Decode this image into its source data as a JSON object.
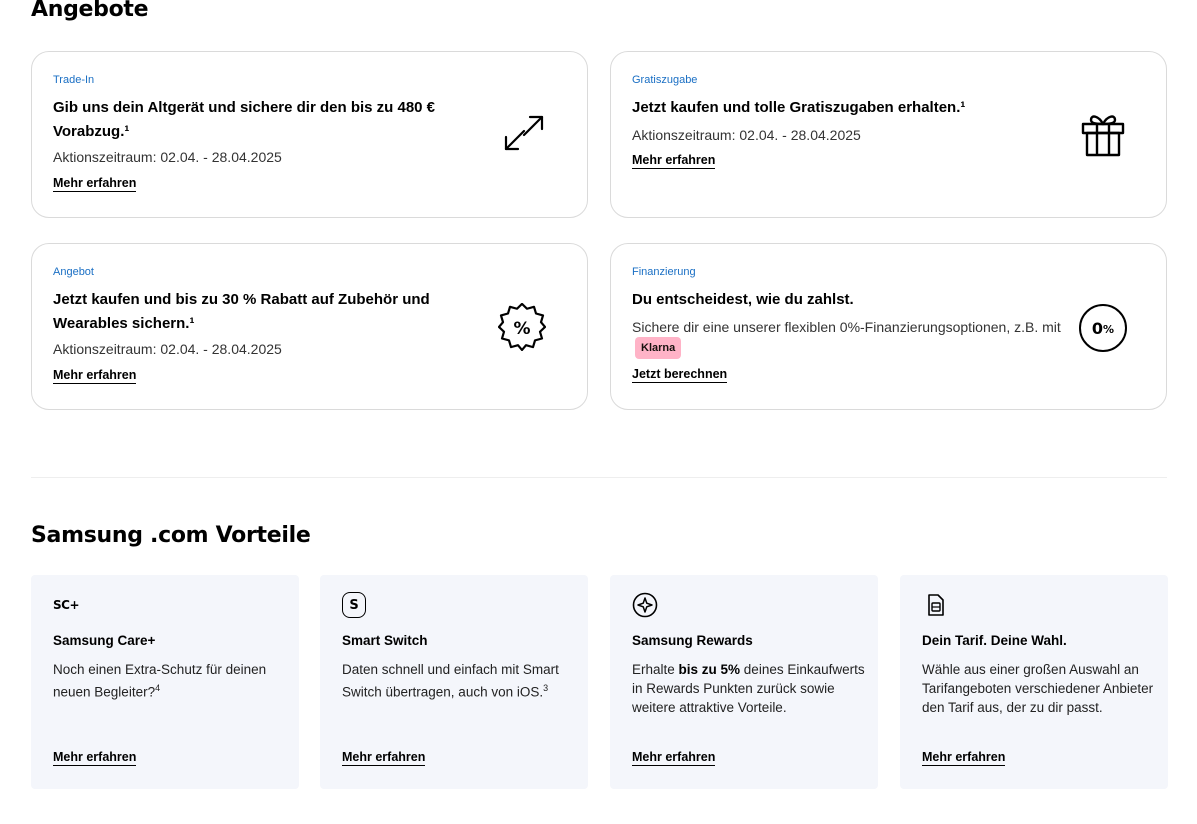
{
  "offers": {
    "title": "Angebote",
    "cards": [
      {
        "eyebrow": "Trade-In",
        "headline": "Gib uns dein Altgerät und sichere dir den bis zu 480 € Vorabzug.¹",
        "sub": "Aktionszeitraum: 02.04. - 28.04.2025",
        "link": "Mehr erfahren",
        "icon": "arrows-swap-icon"
      },
      {
        "eyebrow": "Gratiszugabe",
        "headline": "Jetzt kaufen und tolle Gratiszugaben erhalten.¹",
        "sub": "Aktionszeitraum: 02.04. - 28.04.2025",
        "link": "Mehr erfahren",
        "icon": "gift-icon"
      },
      {
        "eyebrow": "Angebot",
        "headline": "Jetzt kaufen und bis zu 30 % Rabatt auf Zubehör und Wearables sichern.¹",
        "sub": "Aktionszeitraum: 02.04. - 28.04.2025",
        "link": "Mehr erfahren",
        "icon": "percent-badge-icon"
      },
      {
        "eyebrow": "Finanzierung",
        "headline": "Du entscheidest, wie du zahlst.",
        "sub": "Sichere dir eine unserer flexiblen 0%-Finanzierungsoptionen, z.B. mit",
        "badge": "Klarna",
        "link": "Jetzt berechnen",
        "icon": "zero-percent-icon",
        "icon_text": "0",
        "icon_text_small": "%"
      }
    ]
  },
  "benefits": {
    "title": "Samsung .com Vorteile",
    "cards": [
      {
        "icon": "samsung-care-plus-icon",
        "icon_text": "SC+",
        "title": "Samsung Care+",
        "desc": "Noch einen Extra-Schutz für deinen neuen Begleiter?",
        "desc_sup": "4",
        "link": "Mehr erfahren"
      },
      {
        "icon": "smart-switch-icon",
        "icon_text": "S",
        "title": "Smart Switch",
        "desc": "Daten schnell und einfach mit Smart Switch übertragen, auch von iOS.",
        "desc_sup": "3",
        "link": "Mehr erfahren"
      },
      {
        "icon": "rewards-star-icon",
        "title": "Samsung Rewards",
        "desc_pre": "Erhalte ",
        "desc_bold": "bis zu 5%",
        "desc_post": " deines Einkaufwerts in Rewards Punkten zurück sowie weitere attraktive Vorteile.",
        "link": "Mehr erfahren"
      },
      {
        "icon": "sim-card-icon",
        "title": "Dein Tarif. Deine Wahl.",
        "desc": "Wähle aus einer großen Auswahl an Tarifangeboten verschiedener Anbieter den Tarif aus, der zu dir passt.",
        "link": "Mehr erfahren"
      }
    ]
  }
}
